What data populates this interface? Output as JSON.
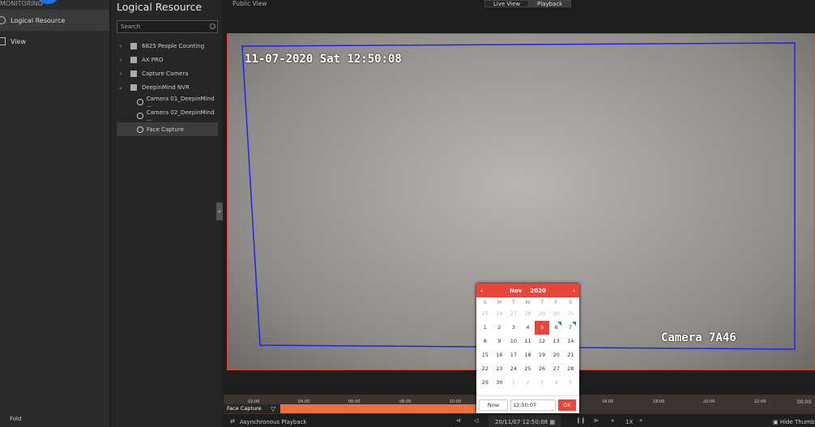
{
  "nav": {
    "brand": "MONITORING",
    "items": [
      {
        "label": "Logical Resource",
        "selected": true
      },
      {
        "label": "View"
      }
    ],
    "fold": "Fold"
  },
  "resource": {
    "title": "Logical Resource",
    "search_placeholder": "Search",
    "tree": [
      {
        "label": "6825 People Counting",
        "type": "group",
        "expanded": false
      },
      {
        "label": "AX PRO",
        "type": "group",
        "expanded": false
      },
      {
        "label": "Capture Camera",
        "type": "group",
        "expanded": false
      },
      {
        "label": "DeepinMind NVR",
        "type": "group",
        "expanded": true
      },
      {
        "label": "Camera 01_DeepinMind ...",
        "type": "camera"
      },
      {
        "label": "Camera 02_DeepinMind ...",
        "type": "camera"
      },
      {
        "label": "Face Capture",
        "type": "camera",
        "selected": true
      }
    ]
  },
  "topbar": {
    "view": "Public View",
    "tabs": [
      "Live View",
      "Playback"
    ],
    "active_tab": "Playback"
  },
  "video": {
    "timestamp": "11-07-2020 Sat 12:50:08",
    "camera_name": "Camera 7A46"
  },
  "timeline": {
    "ticks": [
      "02:00",
      "04:00",
      "06:00",
      "08:00",
      "10:00",
      "16:00",
      "18:00",
      "20:00",
      "22:00",
      "00:00"
    ],
    "track_label": "Face Capture"
  },
  "calendar": {
    "month": "Nov",
    "year": "2020",
    "weekdays": [
      "S",
      "M",
      "T",
      "W",
      "T",
      "F",
      "S"
    ],
    "days": [
      [
        "25",
        "26",
        "27",
        "28",
        "29",
        "30",
        "31"
      ],
      [
        "1",
        "2",
        "3",
        "4",
        "5",
        "6",
        "7"
      ],
      [
        "8",
        "9",
        "10",
        "11",
        "12",
        "13",
        "14"
      ],
      [
        "15",
        "16",
        "17",
        "18",
        "19",
        "20",
        "21"
      ],
      [
        "22",
        "23",
        "24",
        "25",
        "26",
        "27",
        "28"
      ],
      [
        "29",
        "30",
        "1",
        "2",
        "3",
        "4",
        "5"
      ]
    ],
    "selected_day": "5",
    "now": "Now",
    "time": "12:50:07",
    "ok": "OK"
  },
  "controls": {
    "async": "Asynchronous Playback",
    "datetime": "20/11/07 12:50:08",
    "speed": "1X",
    "hide_thumb": "Hide Thumb"
  },
  "colors": {
    "accent": "#e8453c",
    "track": "#f0703b",
    "roi": "#2222ee"
  }
}
